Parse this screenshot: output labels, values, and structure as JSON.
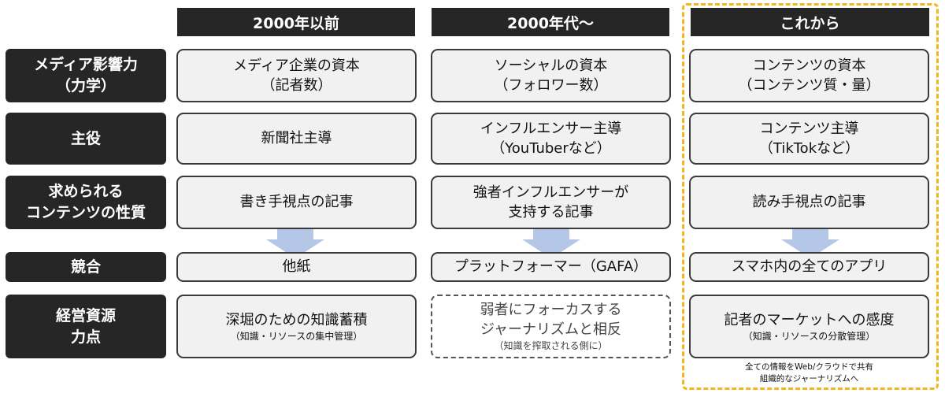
{
  "columns": [
    "2000年以前",
    "2000年代～",
    "これから"
  ],
  "rows": [
    {
      "label_lines": [
        "メディア影響力",
        "（力学）"
      ]
    },
    {
      "label_lines": [
        "主役"
      ]
    },
    {
      "label_lines": [
        "求められる",
        "コンテンツの性質"
      ]
    },
    {
      "label_lines": [
        "競合"
      ]
    },
    {
      "label_lines": [
        "経営資源",
        "力点"
      ]
    }
  ],
  "cells": {
    "media_power": [
      {
        "lines": [
          "メディア企業の資本",
          "（記者数）"
        ]
      },
      {
        "lines": [
          "ソーシャルの資本",
          "（フォロワー数）"
        ]
      },
      {
        "lines": [
          "コンテンツの資本",
          "（コンテンツ質・量）"
        ]
      }
    ],
    "protagonist": [
      {
        "lines": [
          "新聞社主導"
        ]
      },
      {
        "lines": [
          "インフルエンサー主導",
          "（YouTuberなど）"
        ]
      },
      {
        "lines": [
          "コンテンツ主導",
          "（TikTokなど）"
        ]
      }
    ],
    "content_nature": [
      {
        "lines": [
          "書き手視点の記事"
        ]
      },
      {
        "lines": [
          "強者インフルエンサーが",
          "支持する記事"
        ]
      },
      {
        "lines": [
          "読み手視点の記事"
        ]
      }
    ],
    "competition": [
      {
        "lines": [
          "他紙"
        ]
      },
      {
        "lines": [
          "プラットフォーマー（GAFA）"
        ]
      },
      {
        "lines": [
          "スマホ内の全てのアプリ"
        ]
      }
    ],
    "resources": [
      {
        "lines": [
          "深堀のための知識蓄積"
        ],
        "sub": "（知識・リソースの集中管理）"
      },
      {
        "lines": [
          "弱者にフォーカスする",
          "ジャーナリズムと相反"
        ],
        "sub": "（知識を搾取される側に）"
      },
      {
        "lines": [
          "記者のマーケットへの感度"
        ],
        "sub": "（知識・リソースの分散管理）"
      }
    ]
  },
  "footnote_lines": [
    "全ての情報をWeb/クラウドで共有",
    "組織的なジャーナリズムへ"
  ],
  "colors": {
    "dark": "#262626",
    "cell_bg": "#f1f1f1",
    "arrow": "#b4c7e7",
    "highlight": "#f2b51c"
  },
  "icons": [
    "down-arrow-icon"
  ]
}
